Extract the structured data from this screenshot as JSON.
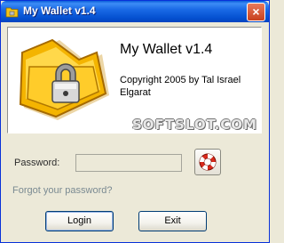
{
  "window": {
    "title": "My Wallet v1.4",
    "close_label": "×"
  },
  "header": {
    "app_name": "My Wallet v1.4",
    "copyright": "Copyright 2005 by Tal Israel Elgarat",
    "watermark": "SOFTSLOT.COM"
  },
  "form": {
    "password_label": "Password:",
    "password_value": "",
    "forgot_link": "Forgot your password?"
  },
  "buttons": {
    "login": "Login",
    "exit": "Exit"
  },
  "colors": {
    "titlebar": "#0a5fda",
    "panel": "#ffffff",
    "window_bg": "#ece9d8",
    "link": "#7a8a92"
  },
  "icons": {
    "app_logo": "folder-lock-icon",
    "help": "lifebuoy-icon",
    "title": "wallet-icon"
  }
}
